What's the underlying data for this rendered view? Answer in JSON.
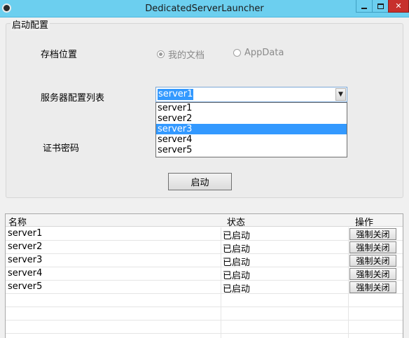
{
  "window": {
    "title": "DedicatedServerLauncher"
  },
  "group": {
    "legend": "启动配置"
  },
  "save_location": {
    "label": "存档位置",
    "options": [
      {
        "label": "我的文档",
        "checked": true
      },
      {
        "label": "AppData",
        "checked": false
      }
    ]
  },
  "server_config": {
    "label": "服务器配置列表",
    "selected_value": "server1",
    "options": [
      "server1",
      "server2",
      "server3",
      "server4",
      "server5"
    ],
    "highlighted_option": "server3"
  },
  "cert_password": {
    "label": "证书密码"
  },
  "start_button": {
    "label": "启动"
  },
  "table": {
    "headers": {
      "name": "名称",
      "status": "状态",
      "action": "操作"
    },
    "rows": [
      {
        "name": "server1",
        "status": "已启动",
        "action": "强制关闭"
      },
      {
        "name": "server2",
        "status": "已启动",
        "action": "强制关闭"
      },
      {
        "name": "server3",
        "status": "已启动",
        "action": "强制关闭"
      },
      {
        "name": "server4",
        "status": "已启动",
        "action": "强制关闭"
      },
      {
        "name": "server5",
        "status": "已启动",
        "action": "强制关闭"
      }
    ]
  }
}
